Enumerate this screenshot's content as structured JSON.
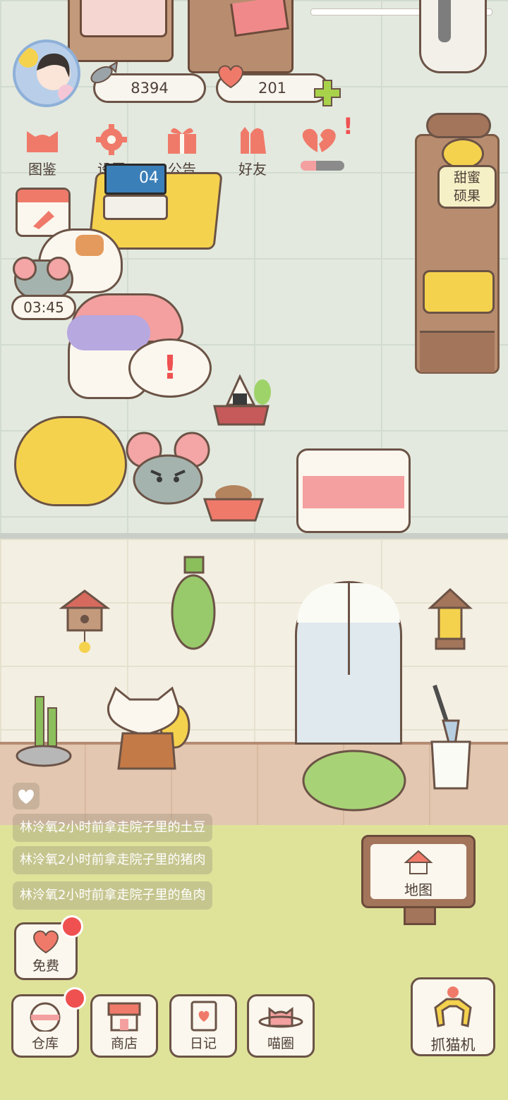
{
  "hud": {
    "fish_count": "8394",
    "heart_count": "201",
    "plus_symbol": "+"
  },
  "menu": [
    {
      "label": "图鉴",
      "icon": "cat-head-icon"
    },
    {
      "label": "设置",
      "icon": "gear-icon"
    },
    {
      "label": "公告",
      "icon": "gift-icon"
    },
    {
      "label": "好友",
      "icon": "friends-icon"
    }
  ],
  "hearts_progress": 0.35,
  "side_label": {
    "line1": "甜蜜",
    "line2": "硕果"
  },
  "timer": "03:45",
  "alert_mark": "!",
  "room_tv_text": "04",
  "feed": [
    "林泠氧2小时前拿走院子里的土豆",
    "林泠氧2小时前拿走院子里的猪肉",
    "林泠氧2小时前拿走院子里的鱼肉"
  ],
  "map_button": "地图",
  "free_button": "免费",
  "bottom_buttons": [
    {
      "label": "仓库",
      "icon": "rice-ball-icon",
      "badge": true
    },
    {
      "label": "商店",
      "icon": "shop-icon",
      "badge": false
    },
    {
      "label": "日记",
      "icon": "diary-icon",
      "badge": false
    },
    {
      "label": "喵圈",
      "icon": "planet-cat-icon",
      "badge": false
    }
  ],
  "claw_button": "抓猫机",
  "colors": {
    "accent_pink": "#f07a6a",
    "badge_red": "#ef5151",
    "outline_brown": "#6b5346"
  }
}
